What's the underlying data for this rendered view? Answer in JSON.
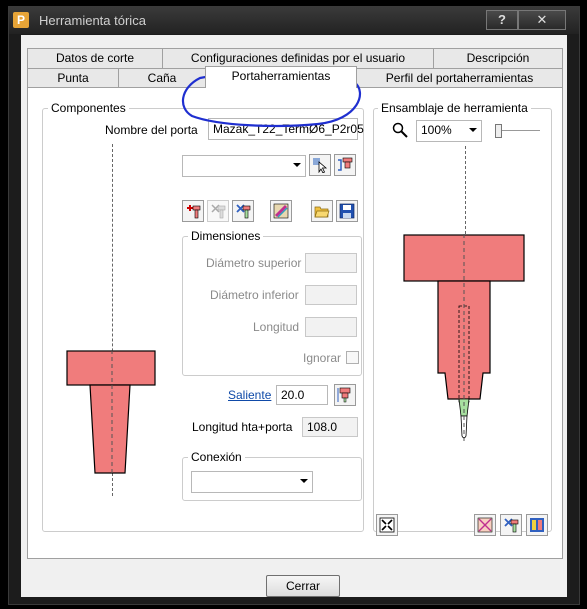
{
  "window": {
    "title": "Herramienta tórica",
    "help_label": "?",
    "close_label": "✕",
    "app_letter": "P"
  },
  "tabs": {
    "row1": [
      "Datos de corte",
      "Configuraciones definidas por el usuario",
      "Descripción"
    ],
    "row2": [
      "Punta",
      "Caña",
      "Portaherramientas",
      "Perfil del portaherramientas"
    ],
    "active": "Portaherramientas"
  },
  "componentes": {
    "title": "Componentes",
    "name_label": "Nombre del porta",
    "name_value": "Mazak_T22_TermØ6_P2r05",
    "combo_value": ""
  },
  "dimensiones": {
    "title": "Dimensiones",
    "diam_sup_label": "Diámetro superior",
    "diam_inf_label": "Diámetro inferior",
    "longitud_label": "Longitud",
    "ignorar_label": "Ignorar"
  },
  "saliente": {
    "label": "Saliente",
    "value": "20.0"
  },
  "longitud_hta": {
    "label": "Longitud hta+porta",
    "value": "108.0"
  },
  "conexion": {
    "title": "Conexión",
    "value": ""
  },
  "ensamblaje": {
    "title": "Ensamblaje de herramienta",
    "zoom_value": "100%"
  },
  "footer": {
    "close_label": "Cerrar"
  },
  "colors": {
    "holder": "#f07c7c",
    "tip": "#a8e0a0",
    "annotation": "#1f2fd0"
  }
}
